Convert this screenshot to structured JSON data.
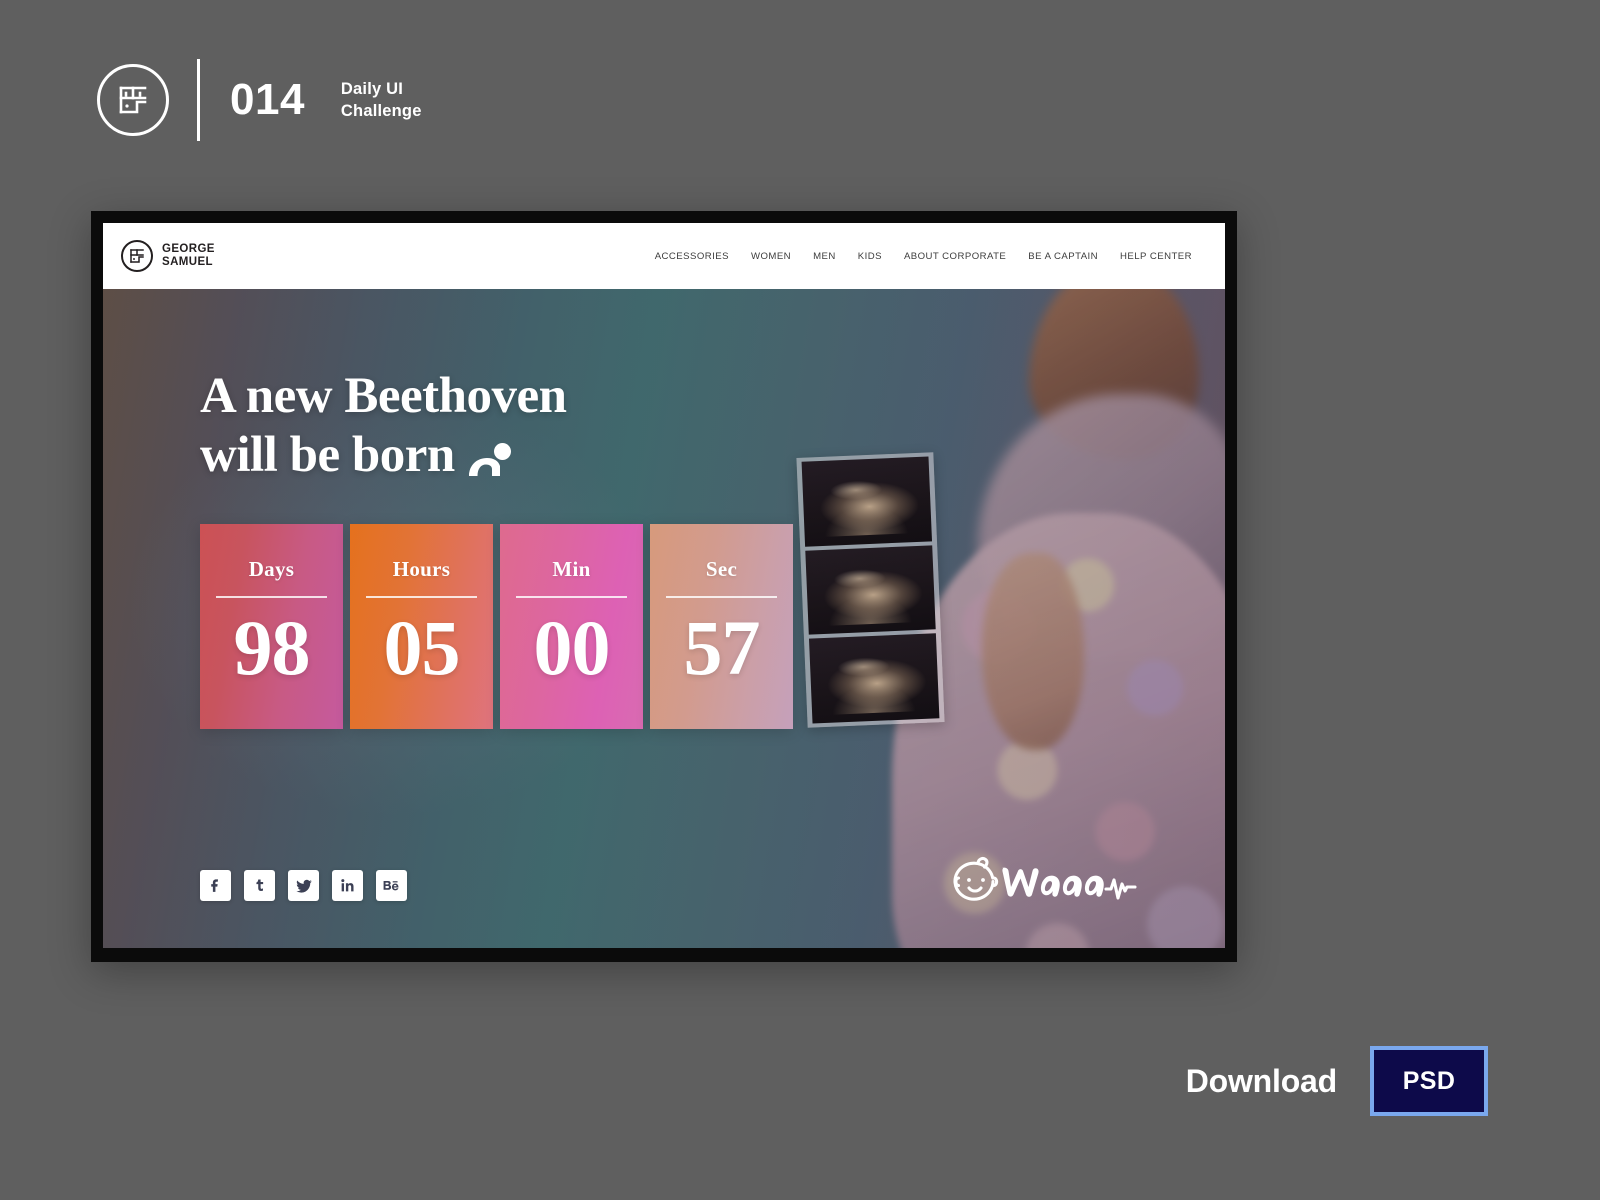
{
  "topbar": {
    "logo_icon": "george-samuel-monogram-icon",
    "challenge_number": "014",
    "challenge_line1": "Daily UI",
    "challenge_line2": "Challenge"
  },
  "site": {
    "logo_icon": "george-samuel-monogram-icon",
    "logo_line1": "GEORGE",
    "logo_line2": "SAMUEL",
    "nav": [
      {
        "label": "ACCESSORIES"
      },
      {
        "label": "WOMEN"
      },
      {
        "label": "MEN"
      },
      {
        "label": "KIDS"
      },
      {
        "label": "ABOUT CORPORATE"
      },
      {
        "label": "BE A CAPTAIN"
      },
      {
        "label": "HELP CENTER"
      }
    ]
  },
  "hero": {
    "headline_line1": "A new Beethoven",
    "headline_line2": "will be born",
    "headline_icon": "crawling-baby-icon",
    "photo_alt": "pregnant-woman-holding-ultrasound-photos",
    "ultrasound_count": 3
  },
  "countdown": {
    "units": [
      {
        "label": "Days",
        "value": "98",
        "accent_from": "#cc5154",
        "accent_to": "#c55a9e"
      },
      {
        "label": "Hours",
        "value": "05",
        "accent_from": "#e5711d",
        "accent_to": "#df737e"
      },
      {
        "label": "Min",
        "value": "00",
        "accent_from": "#de6a8e",
        "accent_to": "#d96bb2"
      },
      {
        "label": "Sec",
        "value": "57",
        "accent_from": "#d79a7c",
        "accent_to": "#c5a0bb"
      }
    ]
  },
  "social": [
    {
      "name": "facebook-icon",
      "label": "Facebook"
    },
    {
      "name": "twitter-old-icon",
      "label": "Twitter"
    },
    {
      "name": "twitter-bird-icon",
      "label": "Twitter"
    },
    {
      "name": "linkedin-icon",
      "label": "LinkedIn"
    },
    {
      "name": "behance-icon",
      "label": "Behance"
    }
  ],
  "waaaa": {
    "icon": "baby-face-icon",
    "wordmark": "Waaaa",
    "accent_icon": "heartbeat-icon"
  },
  "download": {
    "label": "Download",
    "format": "PSD",
    "badge_fill": "#0d0a4a",
    "badge_border": "#7aa8ee"
  },
  "theme": {
    "page_background": "#5f5f5f",
    "frame_color": "#0b0b0b",
    "nav_text": "#3d3d3d",
    "logo_color": "#231f20"
  }
}
